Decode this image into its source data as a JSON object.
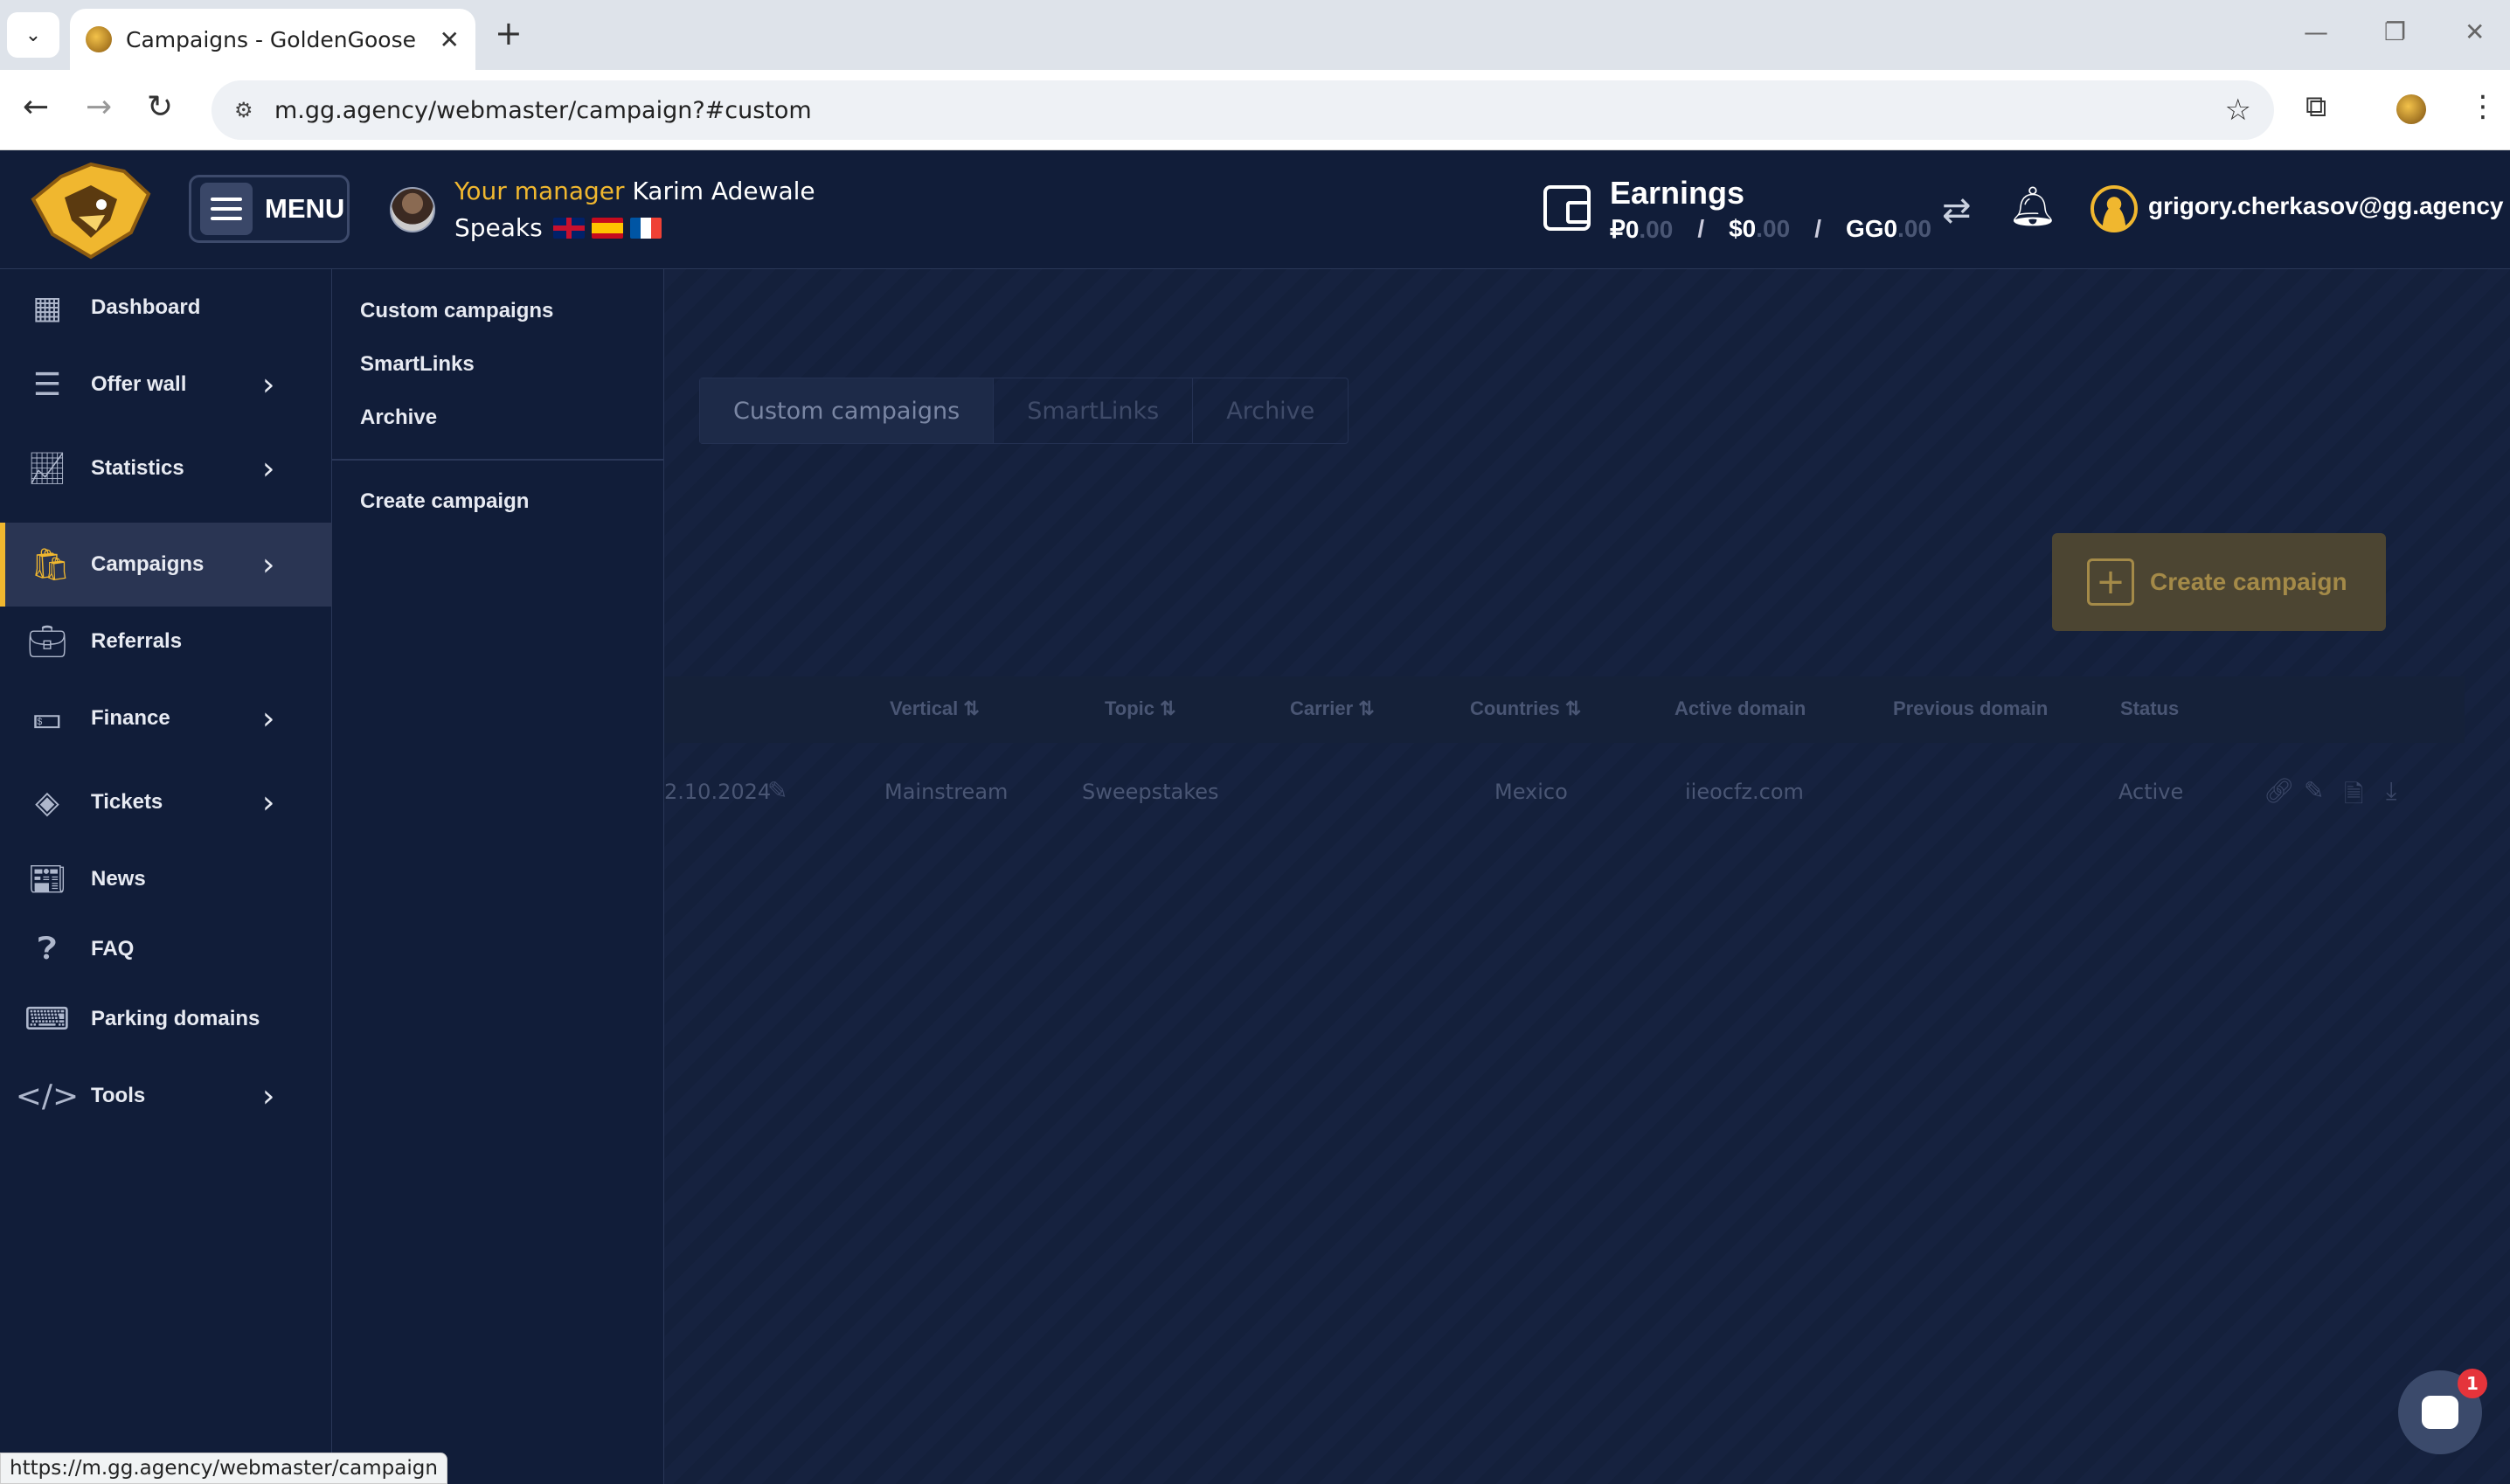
{
  "browser": {
    "tab_title": "Campaigns - GoldenGoose",
    "url": "m.gg.agency/webmaster/campaign?#custom",
    "status_url": "https://m.gg.agency/webmaster/campaign"
  },
  "header": {
    "menu_label": "MENU",
    "manager_prefix": "Your manager",
    "manager_name": "Karim Adewale",
    "speaks_label": "Speaks",
    "earnings_title": "Earnings",
    "earnings": [
      {
        "int": "₽0",
        "dec": ".00"
      },
      {
        "int": "$0",
        "dec": ".00"
      },
      {
        "int": "GG0",
        "dec": ".00"
      }
    ],
    "user_email": "grigory.cherkasov@gg.agency"
  },
  "sidebar": {
    "items": [
      {
        "label": "Dashboard",
        "icon": "dashboard-icon"
      },
      {
        "label": "Offer wall",
        "icon": "list-icon"
      },
      {
        "label": "Statistics",
        "icon": "chart-icon"
      },
      {
        "label": "Campaigns",
        "icon": "bag-icon"
      },
      {
        "label": "Referrals",
        "icon": "briefcase-icon"
      },
      {
        "label": "Finance",
        "icon": "money-icon"
      },
      {
        "label": "Tickets",
        "icon": "layers-icon"
      },
      {
        "label": "News",
        "icon": "news-icon"
      },
      {
        "label": "FAQ",
        "icon": "question-icon"
      },
      {
        "label": "Parking domains",
        "icon": "code-window-icon"
      },
      {
        "label": "Tools",
        "icon": "code-icon"
      }
    ]
  },
  "submenu": {
    "links": [
      "Custom campaigns",
      "SmartLinks",
      "Archive"
    ],
    "create": "Create campaign"
  },
  "main": {
    "tabs": [
      "Custom campaigns",
      "SmartLinks",
      "Archive"
    ],
    "create_button": "Create campaign",
    "columns": [
      "Vertical",
      "Topic",
      "Carrier",
      "Countries",
      "Active domain",
      "Previous domain",
      "Status"
    ],
    "row": {
      "date": "2.10.2024",
      "vertical": "Mainstream",
      "topic": "Sweepstakes",
      "countries": "Mexico",
      "active_domain": "iieocfz.com",
      "status": "Active"
    }
  },
  "chat": {
    "badge": "1"
  }
}
